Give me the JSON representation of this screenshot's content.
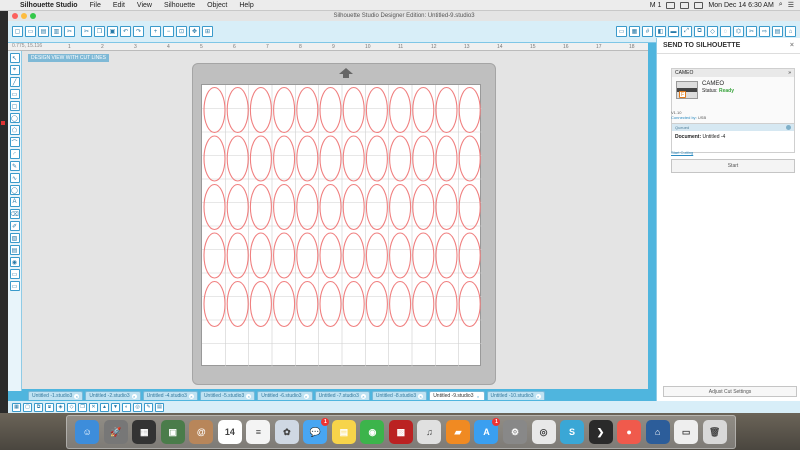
{
  "menubar": {
    "app": "Silhouette Studio",
    "items": [
      "File",
      "Edit",
      "View",
      "Silhouette",
      "Object",
      "Help"
    ],
    "status": {
      "keyboard": "M 1",
      "clock": "Mon Dec 14  6:30 AM"
    }
  },
  "window": {
    "title": "Silhouette Studio Designer Edition: Untitled-9.studio3"
  },
  "ruler": {
    "badge": "0.775, 15.116",
    "ticks": [
      "1",
      "2",
      "3",
      "4",
      "5",
      "6",
      "7",
      "8",
      "9",
      "10",
      "11",
      "12",
      "13",
      "14",
      "15",
      "16",
      "17",
      "18"
    ]
  },
  "canvas": {
    "badge": "DESIGN VIEW WITH CUT LINES"
  },
  "grid": {
    "rows": 5,
    "cols": 12,
    "color": "#f08080"
  },
  "tabs": [
    {
      "label": "Untitled -1.studio3"
    },
    {
      "label": "Untitled -2.studio3"
    },
    {
      "label": "Untitled -4.studio3"
    },
    {
      "label": "Untitled -5.studio3"
    },
    {
      "label": "Untitled -6.studio3"
    },
    {
      "label": "Untitled -7.studio3"
    },
    {
      "label": "Untitled -8.studio3"
    },
    {
      "label": "Untitled -9.studio3"
    },
    {
      "label": "Untitled -10.studio3"
    }
  ],
  "panel": {
    "title": "SEND TO SILHOUETTE",
    "device_header": "CAMEO",
    "device_name": "CAMEO",
    "status_label": "Status:",
    "status_value": "Ready",
    "version": "V1.10",
    "connected_label": "Connected by:",
    "connected_value": "USB",
    "job_header": "Queued",
    "document_label": "Document:",
    "document_value": "Untitled -4",
    "start_cutting": "Start Cutting",
    "start": "Start",
    "adjust": "Adjust Cut Settings"
  },
  "dock": {
    "icons": [
      {
        "name": "finder-icon",
        "color": "#3d8ddb",
        "glyph": "☺"
      },
      {
        "name": "launchpad-icon",
        "color": "#777",
        "glyph": "🚀"
      },
      {
        "name": "mission-control-icon",
        "color": "#333",
        "glyph": "▦"
      },
      {
        "name": "preview-icon",
        "color": "#4a7c4a",
        "glyph": "▣"
      },
      {
        "name": "contacts-icon",
        "color": "#b8865a",
        "glyph": "@"
      },
      {
        "name": "calendar-icon",
        "color": "#fff",
        "glyph": "14"
      },
      {
        "name": "notes-icon",
        "color": "#f4f4f4",
        "glyph": "≡"
      },
      {
        "name": "photos-icon",
        "color": "#cfd8e3",
        "glyph": "✿"
      },
      {
        "name": "messages-icon",
        "color": "#48a6f2",
        "glyph": "💬",
        "badge": "1"
      },
      {
        "name": "stickies-icon",
        "color": "#f7d44a",
        "glyph": "▤"
      },
      {
        "name": "facetime-icon",
        "color": "#3cb44b",
        "glyph": "◉"
      },
      {
        "name": "photobooth-icon",
        "color": "#b22",
        "glyph": "▩"
      },
      {
        "name": "itunes-icon",
        "color": "#e0e0e0",
        "glyph": "♫"
      },
      {
        "name": "ibooks-icon",
        "color": "#f08a22",
        "glyph": "▰"
      },
      {
        "name": "appstore-icon",
        "color": "#3a9ff0",
        "glyph": "A",
        "badge": "1"
      },
      {
        "name": "system-preferences-icon",
        "color": "#888",
        "glyph": "⚙"
      },
      {
        "name": "chrome-icon",
        "color": "#e8e8e8",
        "glyph": "◎"
      },
      {
        "name": "silhouette-icon",
        "color": "#3aa7d6",
        "glyph": "S"
      },
      {
        "name": "terminal-icon",
        "color": "#2a2a2a",
        "glyph": "❯"
      },
      {
        "name": "app-icon",
        "color": "#f05a4c",
        "glyph": "●"
      },
      {
        "name": "remote-icon",
        "color": "#2c5d9a",
        "glyph": "⌂"
      },
      {
        "name": "document-icon",
        "color": "#eee",
        "glyph": "▭"
      },
      {
        "name": "trash-icon",
        "color": "#d8d8d8",
        "glyph": "🗑"
      }
    ]
  }
}
